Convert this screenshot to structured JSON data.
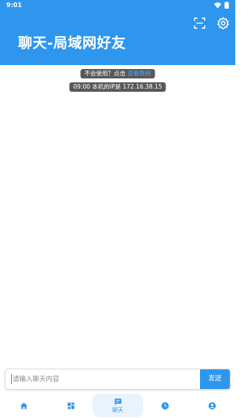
{
  "status_bar": {
    "time": "9:01",
    "icons": [
      "wifi-icon",
      "battery-icon"
    ]
  },
  "header": {
    "title": "聊天-局域网好友",
    "actions": [
      "scan-icon",
      "settings-icon"
    ]
  },
  "messages": [
    {
      "prefix": "不会使用？点击",
      "link": "查看教程"
    },
    {
      "text": "09:00 本机的IP是 172.16.38.15"
    }
  ],
  "input": {
    "placeholder": "请输入聊天内容",
    "value": "",
    "send_label": "发送"
  },
  "bottom_nav": {
    "items": [
      {
        "icon": "home-icon",
        "label": "",
        "active": false
      },
      {
        "icon": "dashboard-icon",
        "label": "",
        "active": false
      },
      {
        "icon": "chat-icon",
        "label": "聊天",
        "active": true
      },
      {
        "icon": "clock-icon",
        "label": "",
        "active": false
      },
      {
        "icon": "account-icon",
        "label": "",
        "active": false
      }
    ]
  },
  "colors": {
    "primary": "#2f96ee",
    "notice_bg": "#585858",
    "active_nav_bg": "#e9f3fd"
  }
}
